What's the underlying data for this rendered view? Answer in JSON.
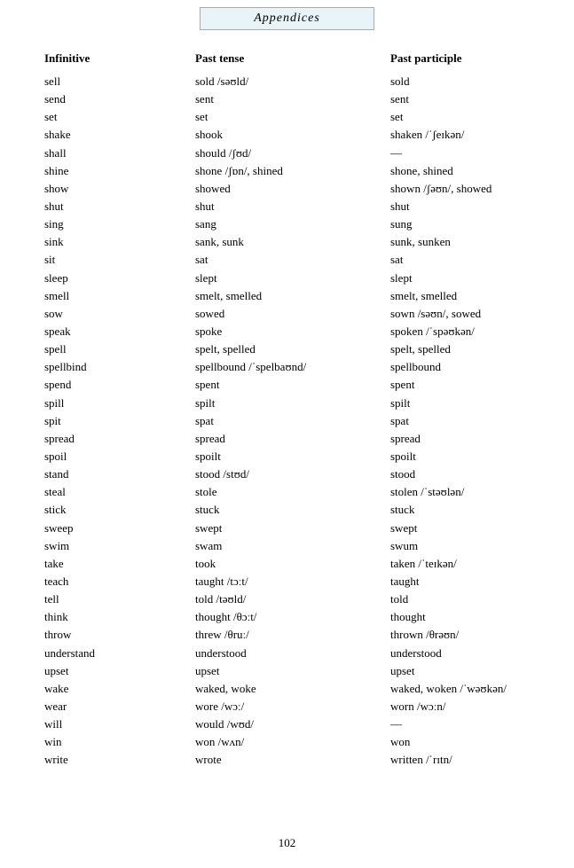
{
  "header": {
    "title": "Appendices"
  },
  "columns": {
    "col1": "Infinitive",
    "col2": "Past tense",
    "col3": "Past participle"
  },
  "rows": [
    [
      "sell",
      "sold /səʊld/",
      "sold"
    ],
    [
      "send",
      "sent",
      "sent"
    ],
    [
      "set",
      "set",
      "set"
    ],
    [
      "shake",
      "shook",
      "shaken /ˈʃeɪkən/"
    ],
    [
      "shall",
      "should /ʃʊd/",
      "—"
    ],
    [
      "shine",
      "shone /ʃɒn/, shined",
      "shone, shined"
    ],
    [
      "show",
      "showed",
      "shown /ʃəʊn/, showed"
    ],
    [
      "shut",
      "shut",
      "shut"
    ],
    [
      "sing",
      "sang",
      "sung"
    ],
    [
      "sink",
      "sank, sunk",
      "sunk, sunken"
    ],
    [
      "sit",
      "sat",
      "sat"
    ],
    [
      "sleep",
      "slept",
      "slept"
    ],
    [
      "smell",
      "smelt, smelled",
      "smelt, smelled"
    ],
    [
      "sow",
      "sowed",
      "sown /səʊn/, sowed"
    ],
    [
      "speak",
      "spoke",
      "spoken /ˈspəʊkən/"
    ],
    [
      "spell",
      "spelt, spelled",
      "spelt, spelled"
    ],
    [
      "spellbind",
      "spellbound /ˈspelbaʊnd/",
      "spellbound"
    ],
    [
      "spend",
      "spent",
      "spent"
    ],
    [
      "spill",
      "spilt",
      "spilt"
    ],
    [
      "spit",
      "spat",
      "spat"
    ],
    [
      "spread",
      "spread",
      "spread"
    ],
    [
      "spoil",
      "spoilt",
      "spoilt"
    ],
    [
      "stand",
      "stood /stʊd/",
      "stood"
    ],
    [
      "steal",
      "stole",
      "stolen /ˈstəʊlən/"
    ],
    [
      "stick",
      "stuck",
      "stuck"
    ],
    [
      "sweep",
      "swept",
      "swept"
    ],
    [
      "swim",
      "swam",
      "swum"
    ],
    [
      "take",
      "took",
      "taken /ˈteɪkən/"
    ],
    [
      "teach",
      "taught /tɔːt/",
      "taught"
    ],
    [
      "tell",
      "told /təʊld/",
      "told"
    ],
    [
      "think",
      "thought /θɔːt/",
      "thought"
    ],
    [
      "throw",
      "threw /θruː/",
      "thrown /θrəʊn/"
    ],
    [
      "understand",
      "understood",
      "understood"
    ],
    [
      "upset",
      "upset",
      "upset"
    ],
    [
      "wake",
      "waked, woke",
      "waked, woken /ˈwəʊkən/"
    ],
    [
      "wear",
      "wore /wɔː/",
      "worn /wɔːn/"
    ],
    [
      "will",
      "would /wʊd/",
      "—"
    ],
    [
      "win",
      "won /wʌn/",
      "won"
    ],
    [
      "write",
      "wrote",
      "written /ˈrɪtn/"
    ]
  ],
  "footer": {
    "page_number": "102"
  }
}
